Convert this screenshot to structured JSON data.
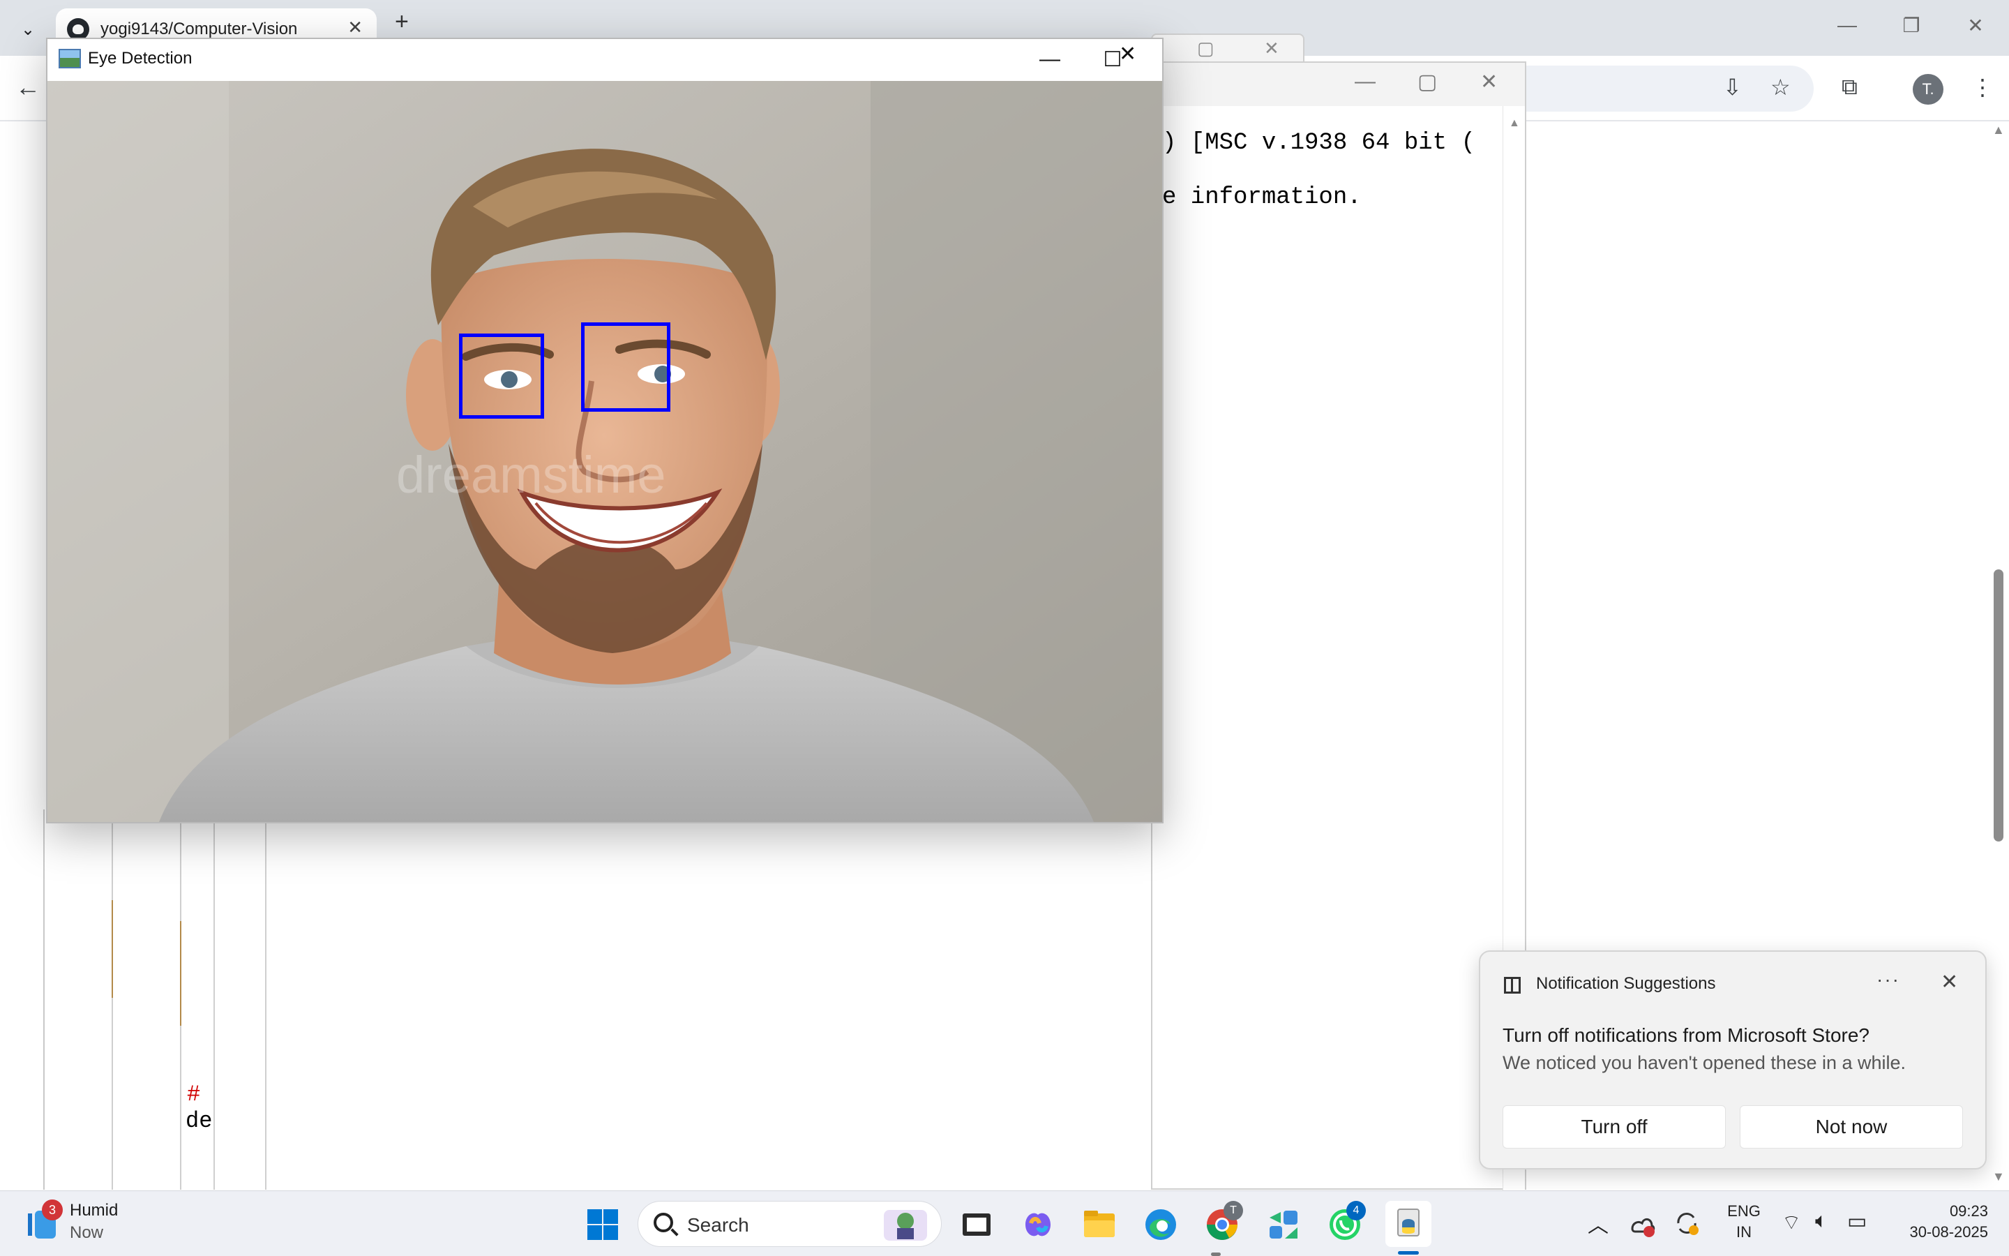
{
  "browser": {
    "tab_title": "yogi9143/Computer-Vision",
    "profile_initial": "T."
  },
  "console": {
    "line1": ") [MSC v.1938 64 bit (",
    "line2": "e information."
  },
  "editor": {
    "comment_char": "#",
    "code_fragment": "de"
  },
  "eye_window": {
    "title": "Eye Detection",
    "photo_watermark": "dreamstime",
    "detections": [
      {
        "label": "left-eye"
      },
      {
        "label": "right-eye"
      }
    ],
    "box_color": "#0000ff"
  },
  "notification": {
    "app_name": "Notification Suggestions",
    "heading": "Turn off notifications from Microsoft Store?",
    "body": "We noticed you haven't opened these in a while.",
    "primary_button": "Turn off",
    "secondary_button": "Not now",
    "more_label": "···"
  },
  "taskbar": {
    "weather_title": "Humid",
    "weather_sub": "Now",
    "weather_badge": "3",
    "search_placeholder": "Search",
    "chrome_badge": "T",
    "whatsapp_badge": "4",
    "lang_line1": "ENG",
    "lang_line2": "IN",
    "time": "09:23",
    "date": "30-08-2025"
  },
  "colors": {
    "accent": "#0067c0",
    "detection_box": "#0000ff",
    "badge_red": "#d13438"
  }
}
